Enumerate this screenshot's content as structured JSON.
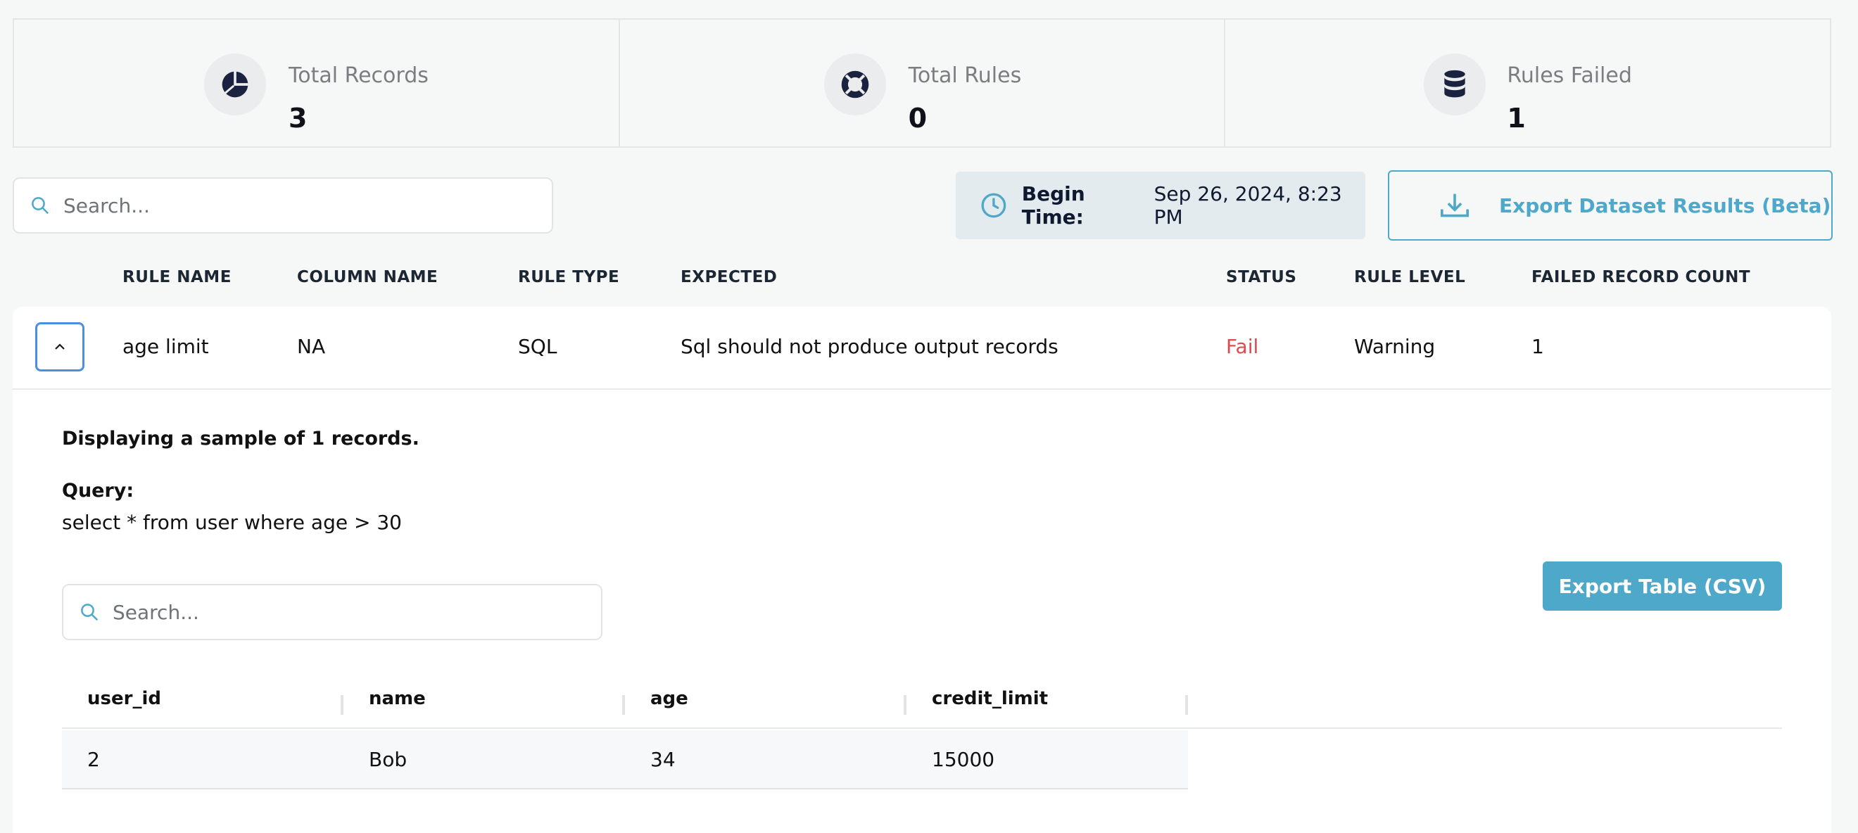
{
  "stats": [
    {
      "label": "Total Records",
      "value": "3",
      "icon": "pie-chart-icon"
    },
    {
      "label": "Total Rules",
      "value": "0",
      "icon": "lifebuoy-icon"
    },
    {
      "label": "Rules Failed",
      "value": "1",
      "icon": "database-icon"
    }
  ],
  "search": {
    "placeholder": "Search..."
  },
  "begin_time": {
    "label": "Begin Time:",
    "value": "Sep 26, 2024, 8:23 PM"
  },
  "export_dataset": {
    "label": "Export Dataset Results (Beta)"
  },
  "rules_table": {
    "headers": [
      "RULE NAME",
      "COLUMN NAME",
      "RULE TYPE",
      "EXPECTED",
      "STATUS",
      "RULE LEVEL",
      "FAILED RECORD COUNT"
    ],
    "rows": [
      {
        "rule_name": "age limit",
        "column_name": "NA",
        "rule_type": "SQL",
        "expected": "Sql should not produce output records",
        "status": "Fail",
        "rule_level": "Warning",
        "failed_count": "1"
      }
    ]
  },
  "details": {
    "sample_text": "Displaying a sample of 1 records.",
    "query_label": "Query:",
    "query": "select * from user where age > 30",
    "search_placeholder": "Search...",
    "export_csv_label": "Export Table (CSV)",
    "columns": [
      "user_id",
      "name",
      "age",
      "credit_limit"
    ],
    "rows": [
      [
        "2",
        "Bob",
        "34",
        "15000"
      ]
    ]
  },
  "colors": {
    "accent": "#4ea8c9",
    "fail": "#e0484a",
    "focus": "#4a90e2",
    "icon_dark": "#1a2240"
  }
}
